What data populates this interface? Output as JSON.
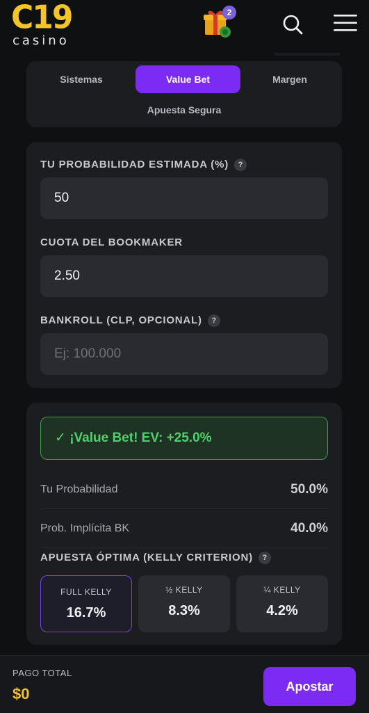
{
  "header": {
    "logo_main": "C19",
    "logo_sub": "casino",
    "gift_badge_count": "2"
  },
  "tabs": [
    {
      "label": "Sistemas",
      "active": false
    },
    {
      "label": "Value Bet",
      "active": true
    },
    {
      "label": "Margen",
      "active": false
    },
    {
      "label": "Apuesta Segura",
      "active": false
    }
  ],
  "form": {
    "probability": {
      "label": "TU PROBABILIDAD ESTIMADA (%)",
      "value": "50",
      "help": "?"
    },
    "odds": {
      "label": "CUOTA DEL BOOKMAKER",
      "value": "2.50"
    },
    "bankroll": {
      "label": "BANKROLL (CLP, OPCIONAL)",
      "value": "",
      "placeholder": "Ej: 100.000",
      "help": "?"
    }
  },
  "result": {
    "banner": "✓ ¡Value Bet!  EV: +25.0%",
    "your_probability_label": "Tu Probabilidad",
    "your_probability_value": "50.0%",
    "implied_probability_label": "Prob. Implícita BK",
    "implied_probability_value": "40.0%",
    "kelly_title": "APUESTA ÓPTIMA (KELLY CRITERION)",
    "kelly_help": "?",
    "kelly_options": [
      {
        "name": "FULL KELLY",
        "value": "16.7%",
        "active": true
      },
      {
        "name": "½ KELLY",
        "value": "8.3%",
        "active": false
      },
      {
        "name": "¼ KELLY",
        "value": "4.2%",
        "active": false
      }
    ]
  },
  "footer": {
    "total_label": "PAGO TOTAL",
    "total_value": "$0",
    "bet_button": "Apostar"
  },
  "colors": {
    "accent": "#7c2bf5",
    "logo_yellow": "#f3c52a",
    "success": "#4fd16b",
    "panel": "#1c1d21",
    "background": "#0f1012"
  },
  "icons": [
    "gift-icon",
    "search-icon",
    "menu-icon",
    "help-icon"
  ]
}
